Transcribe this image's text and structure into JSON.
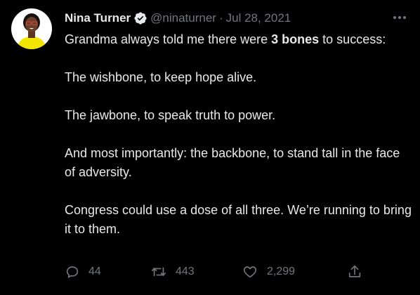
{
  "tweet": {
    "author_name": "Nina Turner",
    "handle": "@ninaturner",
    "separator": "·",
    "date": "Jul 28, 2021",
    "text": {
      "line1_pre": "Grandma always told me there were ",
      "line1_bold": "3 bones",
      "line1_post": " to success:",
      "para2": "The wishbone, to keep hope alive.",
      "para3": "The jawbone, to speak truth to power.",
      "para4": "And most importantly: the backbone, to stand tall in the face of adversity.",
      "para5": "Congress could use a dose of all three. We’re running to bring it to them."
    },
    "actions": {
      "reply_count": "44",
      "retweet_count": "443",
      "like_count": "2,299"
    },
    "icons": {
      "verified": "verified-badge-icon",
      "more": "more-options-icon",
      "reply": "reply-icon",
      "retweet": "retweet-icon",
      "like": "heart-icon",
      "share": "share-icon"
    },
    "colors": {
      "background": "#000000",
      "text": "#e7e9ea",
      "secondary": "#71767b",
      "avatar_shirt": "#f2e600"
    }
  }
}
